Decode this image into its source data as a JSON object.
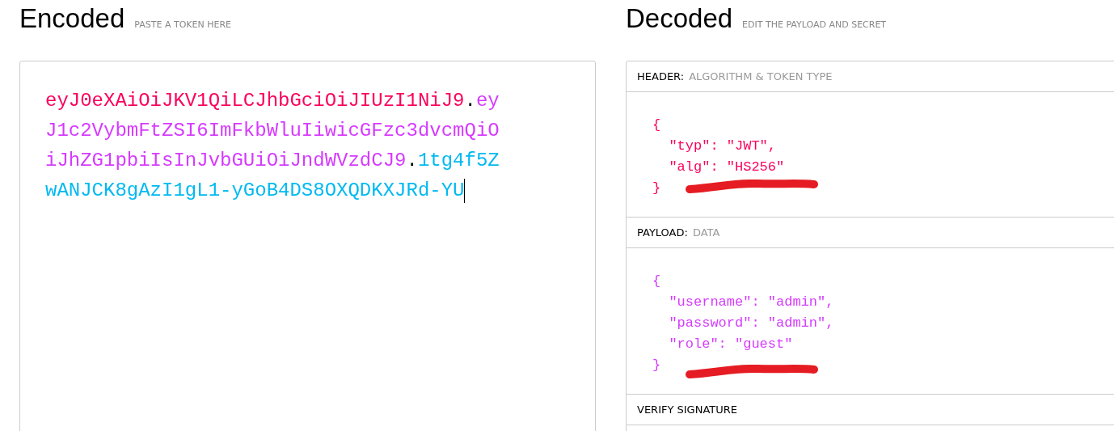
{
  "encoded": {
    "title": "Encoded",
    "subtitle": "PASTE A TOKEN HERE",
    "token_parts": [
      {
        "text": "eyJ0eXAiOiJKV1QiLCJhbGciOiJIUzI1NiJ9",
        "color": "#fb015b"
      },
      {
        "text": ".",
        "color": "#000000"
      },
      {
        "text": "eyJ1c2VybmFtZSI6ImFkbWluIiwicGFzc3dvcmQiOiJhZG1pbiIsInJvbGUiOiJndWVzdCJ9",
        "color": "#d63aff"
      },
      {
        "text": ".",
        "color": "#000000"
      },
      {
        "text": "1tg4f5ZwANJCK8gAzI1gL1-yGoB4DS8OXQDKXJRd-YU",
        "color": "#00b9f1"
      }
    ]
  },
  "decoded": {
    "title": "Decoded",
    "subtitle": "EDIT THE PAYLOAD AND SECRET",
    "sections": [
      {
        "label": "HEADER:",
        "description": "ALGORITHM & TOKEN TYPE",
        "color": "#fb015b",
        "lines": [
          "{",
          "  \"typ\": \"JWT\",",
          "  \"alg\": \"HS256\"",
          "}"
        ]
      },
      {
        "label": "PAYLOAD:",
        "description": "DATA",
        "color": "#d63aff",
        "lines": [
          "{",
          "  \"username\": \"admin\",",
          "  \"password\": \"admin\",",
          "  \"role\": \"guest\"",
          "}"
        ]
      },
      {
        "label": "VERIFY SIGNATURE"
      }
    ]
  }
}
